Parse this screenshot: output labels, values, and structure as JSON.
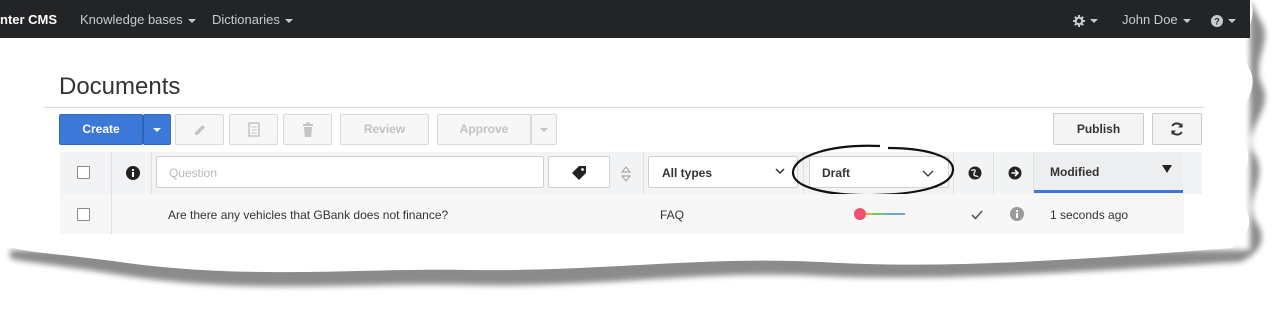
{
  "topnav": {
    "brand": "nter CMS",
    "items": [
      {
        "label": "Knowledge bases"
      },
      {
        "label": "Dictionaries"
      }
    ],
    "user": "John Doe",
    "settings_icon": "gear-icon",
    "help_icon": "question-circle-icon"
  },
  "page": {
    "title": "Documents"
  },
  "toolbar": {
    "create_label": "Create",
    "review_label": "Review",
    "approve_label": "Approve",
    "publish_label": "Publish",
    "icons": [
      "pencil-icon",
      "document-icon",
      "trash-icon",
      "refresh-icon"
    ]
  },
  "filters": {
    "question_placeholder": "Question",
    "type_value": "All types",
    "status_value": "Draft",
    "modified_label": "Modified"
  },
  "rows": [
    {
      "question": "Are there any vehicles that GBank does not finance?",
      "type": "FAQ",
      "modified": "1 seconds ago"
    }
  ],
  "colors": {
    "accent": "#3b78d8",
    "nav_bg": "#222426",
    "status_dot": "#f0506e"
  }
}
